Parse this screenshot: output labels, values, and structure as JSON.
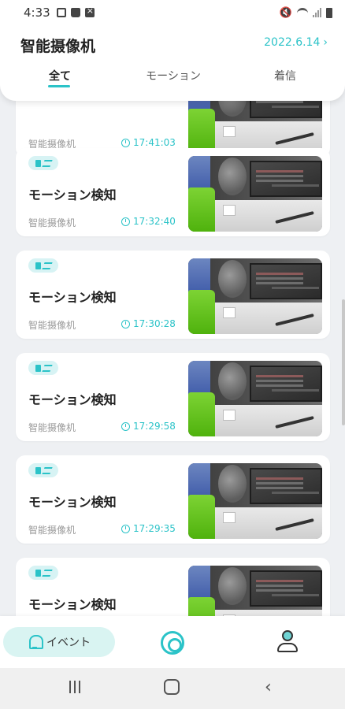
{
  "status_bar": {
    "time": "4:33"
  },
  "header": {
    "title": "智能摄像机",
    "date": "2022.6.14",
    "tabs": [
      {
        "label": "全て"
      },
      {
        "label": "モーション"
      },
      {
        "label": "着信"
      }
    ]
  },
  "events": [
    {
      "title": "",
      "source": "智能摄像机",
      "time": "17:41:03"
    },
    {
      "title": "モーション検知",
      "source": "智能摄像机",
      "time": "17:32:40"
    },
    {
      "title": "モーション検知",
      "source": "智能摄像机",
      "time": "17:30:28"
    },
    {
      "title": "モーション検知",
      "source": "智能摄像机",
      "time": "17:29:58"
    },
    {
      "title": "モーション検知",
      "source": "智能摄像机",
      "time": "17:29:35"
    },
    {
      "title": "モーション検知",
      "source": "",
      "time": ""
    }
  ],
  "bottom_nav": {
    "event_label": "イベント"
  },
  "colors": {
    "accent": "#2bc3c8",
    "badge_bg": "#d7f3f4",
    "page_bg": "#eef0f3"
  }
}
